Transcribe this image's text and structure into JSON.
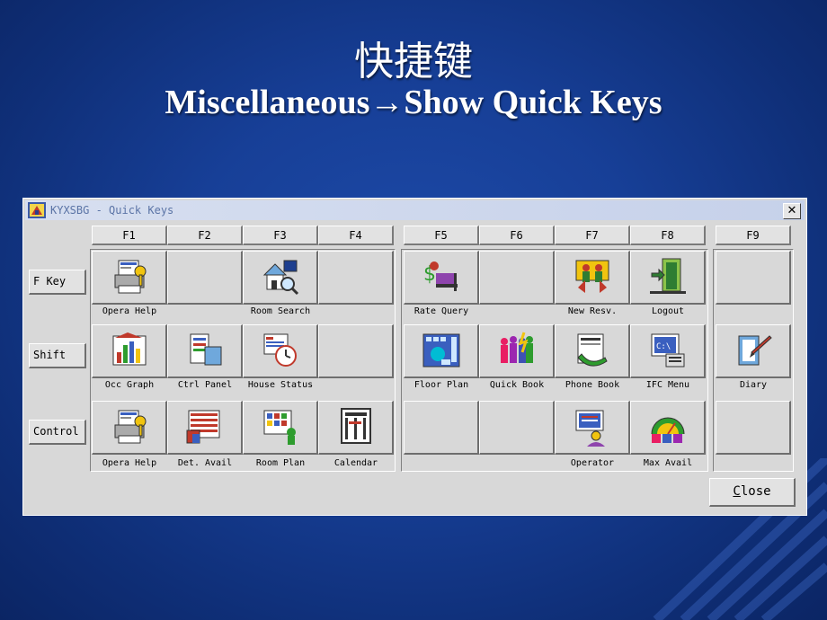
{
  "slide": {
    "title_cn": "快捷键",
    "title_en": "Miscellaneous→Show Quick Keys"
  },
  "window": {
    "title": "KYXSBG - Quick Keys",
    "close_glyph": "✕",
    "close_button": "Close"
  },
  "headers": [
    "F1",
    "F2",
    "F3",
    "F4",
    "F5",
    "F6",
    "F7",
    "F8",
    "F9"
  ],
  "rows": [
    {
      "label": "F Key",
      "keys": [
        {
          "caption": "Opera Help",
          "icon": "opera-help-icon"
        },
        {
          "caption": "",
          "icon": ""
        },
        {
          "caption": "Room Search",
          "icon": "room-search-icon"
        },
        {
          "caption": "",
          "icon": ""
        },
        {
          "caption": "Rate Query",
          "icon": "rate-query-icon"
        },
        {
          "caption": "",
          "icon": ""
        },
        {
          "caption": "New Resv.",
          "icon": "new-reservation-icon"
        },
        {
          "caption": "Logout",
          "icon": "logout-icon"
        },
        {
          "caption": "",
          "icon": ""
        }
      ]
    },
    {
      "label": "Shift",
      "keys": [
        {
          "caption": "Occ Graph",
          "icon": "occupancy-graph-icon"
        },
        {
          "caption": "Ctrl Panel",
          "icon": "control-panel-icon"
        },
        {
          "caption": "House Status",
          "icon": "house-status-icon"
        },
        {
          "caption": "",
          "icon": ""
        },
        {
          "caption": "Floor Plan",
          "icon": "floor-plan-icon"
        },
        {
          "caption": "Quick Book",
          "icon": "quick-book-icon"
        },
        {
          "caption": "Phone Book",
          "icon": "phone-book-icon"
        },
        {
          "caption": "IFC Menu",
          "icon": "ifc-menu-icon"
        },
        {
          "caption": "Diary",
          "icon": "diary-icon"
        }
      ]
    },
    {
      "label": "Control",
      "keys": [
        {
          "caption": "Opera Help",
          "icon": "opera-help-icon"
        },
        {
          "caption": "Det. Avail",
          "icon": "detailed-availability-icon"
        },
        {
          "caption": "Room Plan",
          "icon": "room-plan-icon"
        },
        {
          "caption": "Calendar",
          "icon": "calendar-icon"
        },
        {
          "caption": "",
          "icon": ""
        },
        {
          "caption": "",
          "icon": ""
        },
        {
          "caption": "Operator",
          "icon": "operator-icon"
        },
        {
          "caption": "Max Avail",
          "icon": "max-availability-icon"
        },
        {
          "caption": "",
          "icon": ""
        }
      ]
    }
  ]
}
